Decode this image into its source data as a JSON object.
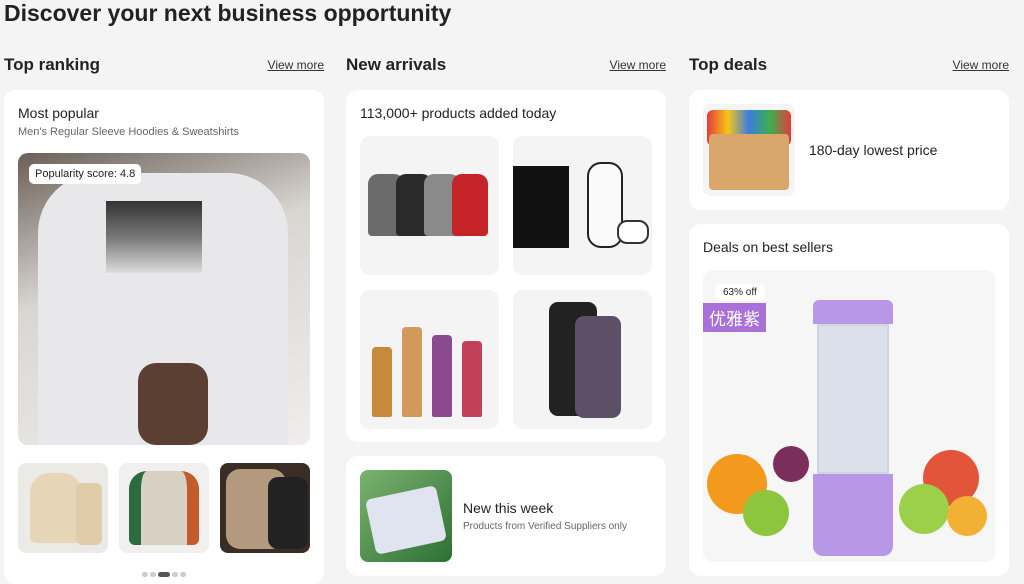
{
  "page": {
    "title": "Discover your next business opportunity"
  },
  "columns": {
    "top_ranking": {
      "heading": "Top ranking",
      "view_more": "View more",
      "card": {
        "title": "Most popular",
        "subtitle": "Men's Regular Sleeve Hoodies & Sweatshirts",
        "popularity_label": "Popularity score:",
        "popularity_value": "4.8",
        "carousel_pages": 5,
        "carousel_active": 3
      }
    },
    "new_arrivals": {
      "heading": "New arrivals",
      "view_more": "View more",
      "card_title": "113,000+ products added today",
      "week_title": "New this week",
      "week_subtitle": "Products from Verified Suppliers only"
    },
    "top_deals": {
      "heading": "Top deals",
      "view_more": "View more",
      "deal_text": "180-day lowest price",
      "best_title": "Deals on best sellers",
      "off_badge": "63% off",
      "brand_tag": "优雅紫"
    }
  },
  "colors": {
    "background": "#f4f4f4",
    "card": "#ffffff",
    "accent_purple": "#a970d8"
  },
  "icons": [
    "hoodie-image",
    "jacket-image",
    "console-image",
    "perfume-image",
    "phone-image",
    "snack-box-image",
    "blender-image"
  ]
}
